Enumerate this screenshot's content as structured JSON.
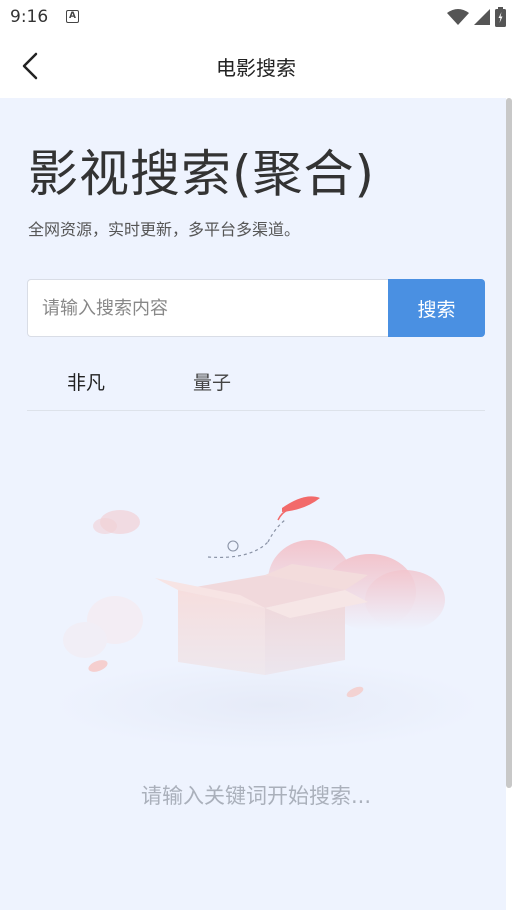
{
  "status_bar": {
    "time": "9:16",
    "notification_icon": "a-badge-icon",
    "icons": [
      "wifi-icon",
      "signal-icon",
      "battery-icon"
    ]
  },
  "header": {
    "title": "电影搜索",
    "back_icon": "chevron-left-icon"
  },
  "hero": {
    "title": "影视搜索(聚合)",
    "subtitle": "全网资源，实时更新，多平台多渠道。"
  },
  "search": {
    "placeholder": "请输入搜索内容",
    "value": "",
    "button_label": "搜索"
  },
  "tabs": [
    {
      "label": "非凡"
    },
    {
      "label": "量子"
    }
  ],
  "empty_state": {
    "illustration": "empty-box-illustration",
    "message": "请输入关键词开始搜索..."
  },
  "colors": {
    "accent": "#4a90e2",
    "background": "#eef3fe",
    "header": "#ffffff"
  }
}
